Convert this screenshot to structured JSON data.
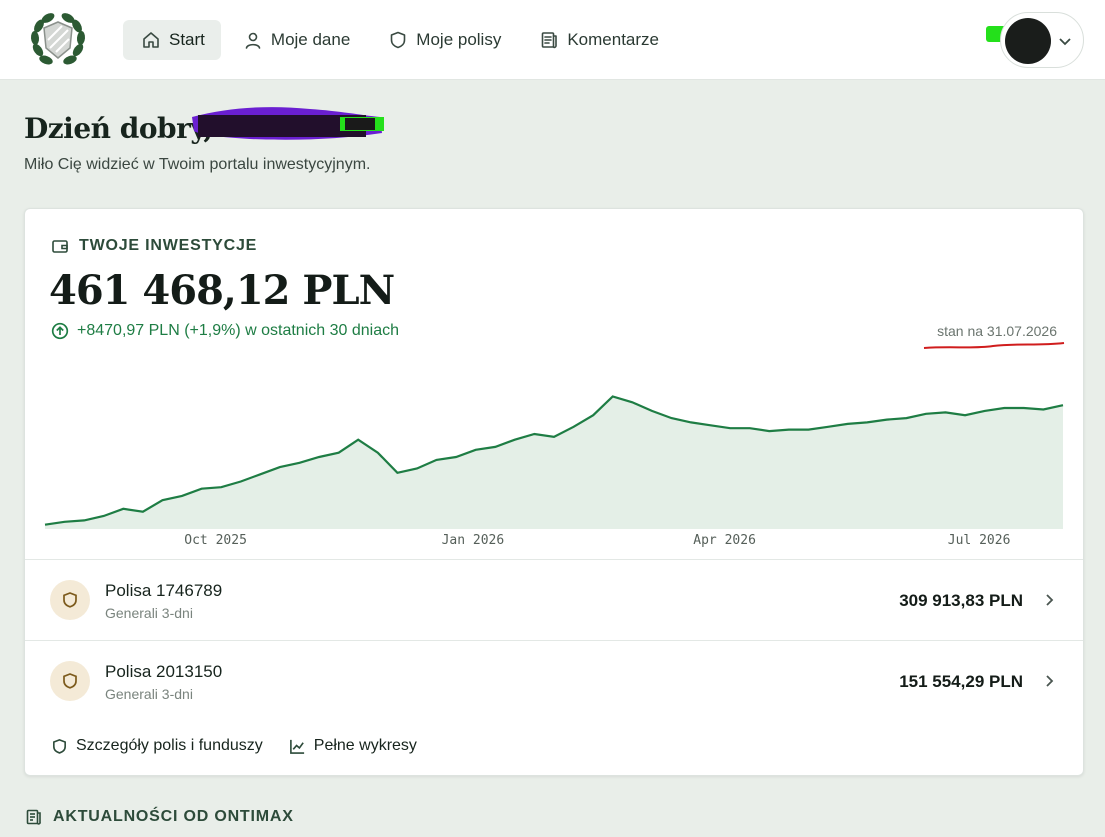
{
  "nav": {
    "items": [
      {
        "label": "Start",
        "icon": "home-icon",
        "active": true
      },
      {
        "label": "Moje dane",
        "icon": "user-icon",
        "active": false
      },
      {
        "label": "Moje polisy",
        "icon": "shield-icon",
        "active": false
      },
      {
        "label": "Komentarze",
        "icon": "document-icon",
        "active": false
      }
    ]
  },
  "greeting": {
    "title": "Dzień dobry,",
    "subtitle": "Miło Cię widzieć w Twoim portalu inwestycyjnym."
  },
  "investments": {
    "heading": "TWOJE INWESTYCJE",
    "total": "461 468,12 PLN",
    "change": "+8470,97 PLN (+1,9%) w ostatnich 30 dniach",
    "as_of": "stan na 31.07.2026"
  },
  "chart_data": {
    "type": "area",
    "series": [
      {
        "x": [
          "2025-08-01",
          "2025-08-08",
          "2025-08-15",
          "2025-08-22",
          "2025-08-29",
          "2025-09-05",
          "2025-09-12",
          "2025-09-19",
          "2025-09-26",
          "2025-10-03",
          "2025-10-10",
          "2025-10-17",
          "2025-10-24",
          "2025-10-31",
          "2025-11-07",
          "2025-11-14",
          "2025-11-21",
          "2025-11-28",
          "2025-12-05",
          "2025-12-12",
          "2025-12-19",
          "2025-12-26",
          "2026-01-02",
          "2026-01-09",
          "2026-01-16",
          "2026-01-23",
          "2026-01-30",
          "2026-02-06",
          "2026-02-13",
          "2026-02-20",
          "2026-02-27",
          "2026-03-06",
          "2026-03-13",
          "2026-03-20",
          "2026-03-27",
          "2026-04-03",
          "2026-04-10",
          "2026-04-17",
          "2026-04-24",
          "2026-05-01",
          "2026-05-08",
          "2026-05-15",
          "2026-05-22",
          "2026-05-29",
          "2026-06-05",
          "2026-06-12",
          "2026-06-19",
          "2026-06-26",
          "2026-07-03",
          "2026-07-10",
          "2026-07-17",
          "2026-07-24",
          "2026-07-31"
        ],
        "values": [
          0.03,
          0.05,
          0.06,
          0.09,
          0.14,
          0.12,
          0.2,
          0.23,
          0.28,
          0.29,
          0.33,
          0.38,
          0.43,
          0.46,
          0.5,
          0.53,
          0.62,
          0.53,
          0.39,
          0.42,
          0.48,
          0.5,
          0.55,
          0.57,
          0.62,
          0.66,
          0.64,
          0.71,
          0.79,
          0.92,
          0.88,
          0.82,
          0.77,
          0.74,
          0.72,
          0.7,
          0.7,
          0.68,
          0.69,
          0.69,
          0.71,
          0.73,
          0.74,
          0.76,
          0.77,
          0.8,
          0.81,
          0.79,
          0.82,
          0.84,
          0.84,
          0.83,
          0.86
        ]
      }
    ],
    "x_ticks": [
      "Oct 2025",
      "Jan 2026",
      "Apr 2026",
      "Jul 2026"
    ],
    "grid": false,
    "colors": {
      "line": "#1e7d44",
      "fill": "#e4efe7"
    }
  },
  "policies": [
    {
      "name": "Polisa 1746789",
      "provider": "Generali 3-dni",
      "amount": "309 913,83 PLN"
    },
    {
      "name": "Polisa 2013150",
      "provider": "Generali 3-dni",
      "amount": "151 554,29 PLN"
    }
  ],
  "links": {
    "details": "Szczegóły polis i funduszy",
    "charts": "Pełne wykresy"
  },
  "news": {
    "heading": "AKTUALNOŚCI OD ONTIMAX"
  }
}
